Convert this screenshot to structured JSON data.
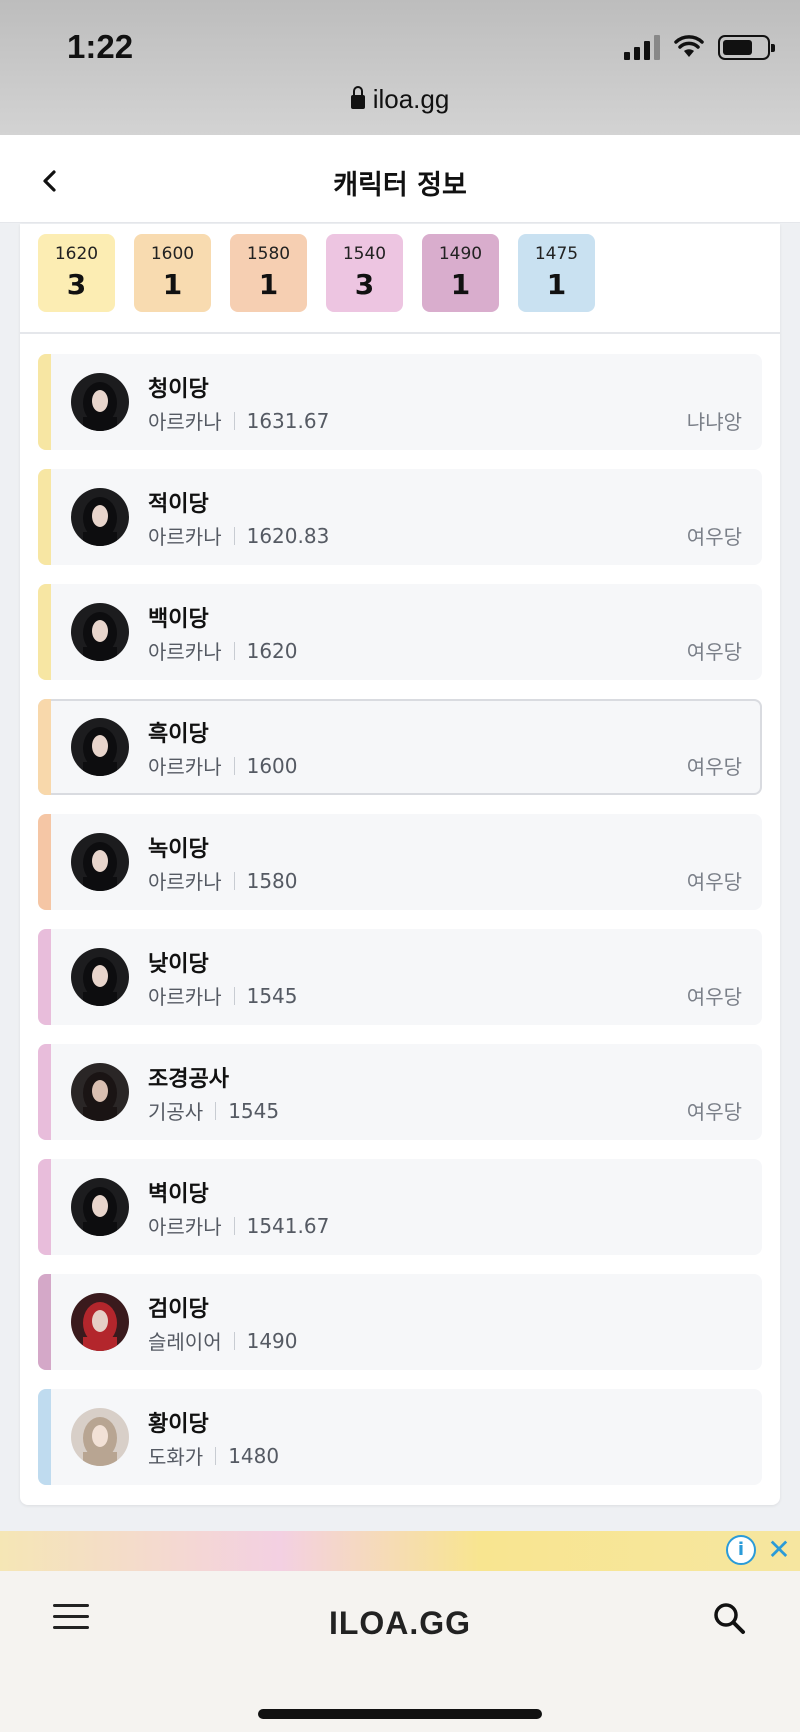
{
  "status_bar": {
    "time": "1:22"
  },
  "browser": {
    "url": "iloa.gg"
  },
  "header": {
    "title": "캐릭터 정보"
  },
  "level_chips": [
    {
      "level": "1620",
      "count": "3",
      "color": "#fcedb3"
    },
    {
      "level": "1600",
      "count": "1",
      "color": "#f8dbb0"
    },
    {
      "level": "1580",
      "count": "1",
      "color": "#f6cfb2"
    },
    {
      "level": "1540",
      "count": "3",
      "color": "#edc5e1"
    },
    {
      "level": "1490",
      "count": "1",
      "color": "#d9adcd"
    },
    {
      "level": "1475",
      "count": "1",
      "color": "#c9e1f1"
    }
  ],
  "characters": [
    {
      "name": "청이당",
      "class": "아르카나",
      "item_level": "1631.67",
      "server": "냐냐앙",
      "bar_color": "#f7e6a3",
      "avatar": "dark-hair"
    },
    {
      "name": "적이당",
      "class": "아르카나",
      "item_level": "1620.83",
      "server": "여우당",
      "bar_color": "#f7e6a3",
      "avatar": "dark-hair"
    },
    {
      "name": "백이당",
      "class": "아르카나",
      "item_level": "1620",
      "server": "여우당",
      "bar_color": "#f7e6a3",
      "avatar": "dark-hair"
    },
    {
      "name": "흑이당",
      "class": "아르카나",
      "item_level": "1600",
      "server": "여우당",
      "bar_color": "#f8d8ab",
      "avatar": "dark-hair"
    },
    {
      "name": "녹이당",
      "class": "아르카나",
      "item_level": "1580",
      "server": "여우당",
      "bar_color": "#f5c6a5",
      "avatar": "dark-hair"
    },
    {
      "name": "낮이당",
      "class": "아르카나",
      "item_level": "1545",
      "server": "여우당",
      "bar_color": "#e8bddb",
      "avatar": "dark-hair"
    },
    {
      "name": "조경공사",
      "class": "기공사",
      "item_level": "1545",
      "server": "여우당",
      "bar_color": "#e8bddb",
      "avatar": "short-hair"
    },
    {
      "name": "벽이당",
      "class": "아르카나",
      "item_level": "1541.67",
      "server": "",
      "bar_color": "#e8bddb",
      "avatar": "dark-hair"
    },
    {
      "name": "검이당",
      "class": "슬레이어",
      "item_level": "1490",
      "server": "",
      "bar_color": "#d4a8c8",
      "avatar": "red-hair"
    },
    {
      "name": "황이당",
      "class": "도화가",
      "item_level": "1480",
      "server": "",
      "bar_color": "#bfdbef",
      "avatar": "light-hair"
    }
  ],
  "bottom_bar": {
    "brand": "ILOA.GG"
  }
}
